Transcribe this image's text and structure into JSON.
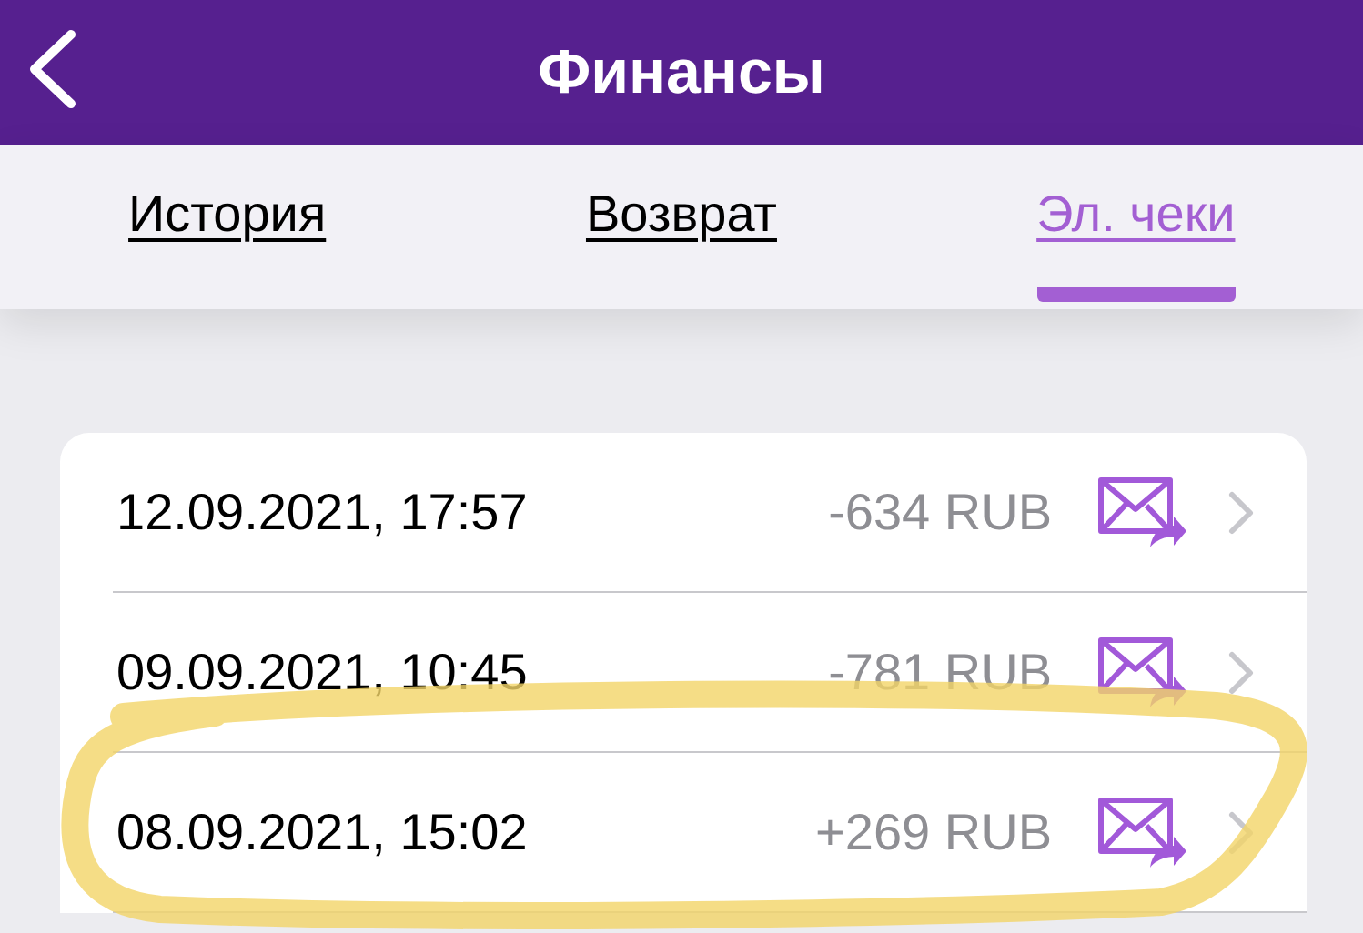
{
  "header": {
    "title": "Финансы"
  },
  "tabs": [
    {
      "label": "История",
      "selected": false
    },
    {
      "label": "Возврат",
      "selected": false
    },
    {
      "label": "Эл. чеки",
      "selected": true
    }
  ],
  "receipts": [
    {
      "date": "12.09.2021, 17:57",
      "amount": "-634 RUB"
    },
    {
      "date": "09.09.2021, 10:45",
      "amount": "-781 RUB"
    },
    {
      "date": "08.09.2021, 15:02",
      "amount": "+269 RUB"
    }
  ],
  "annotation": {
    "kind": "highlight-loop"
  }
}
